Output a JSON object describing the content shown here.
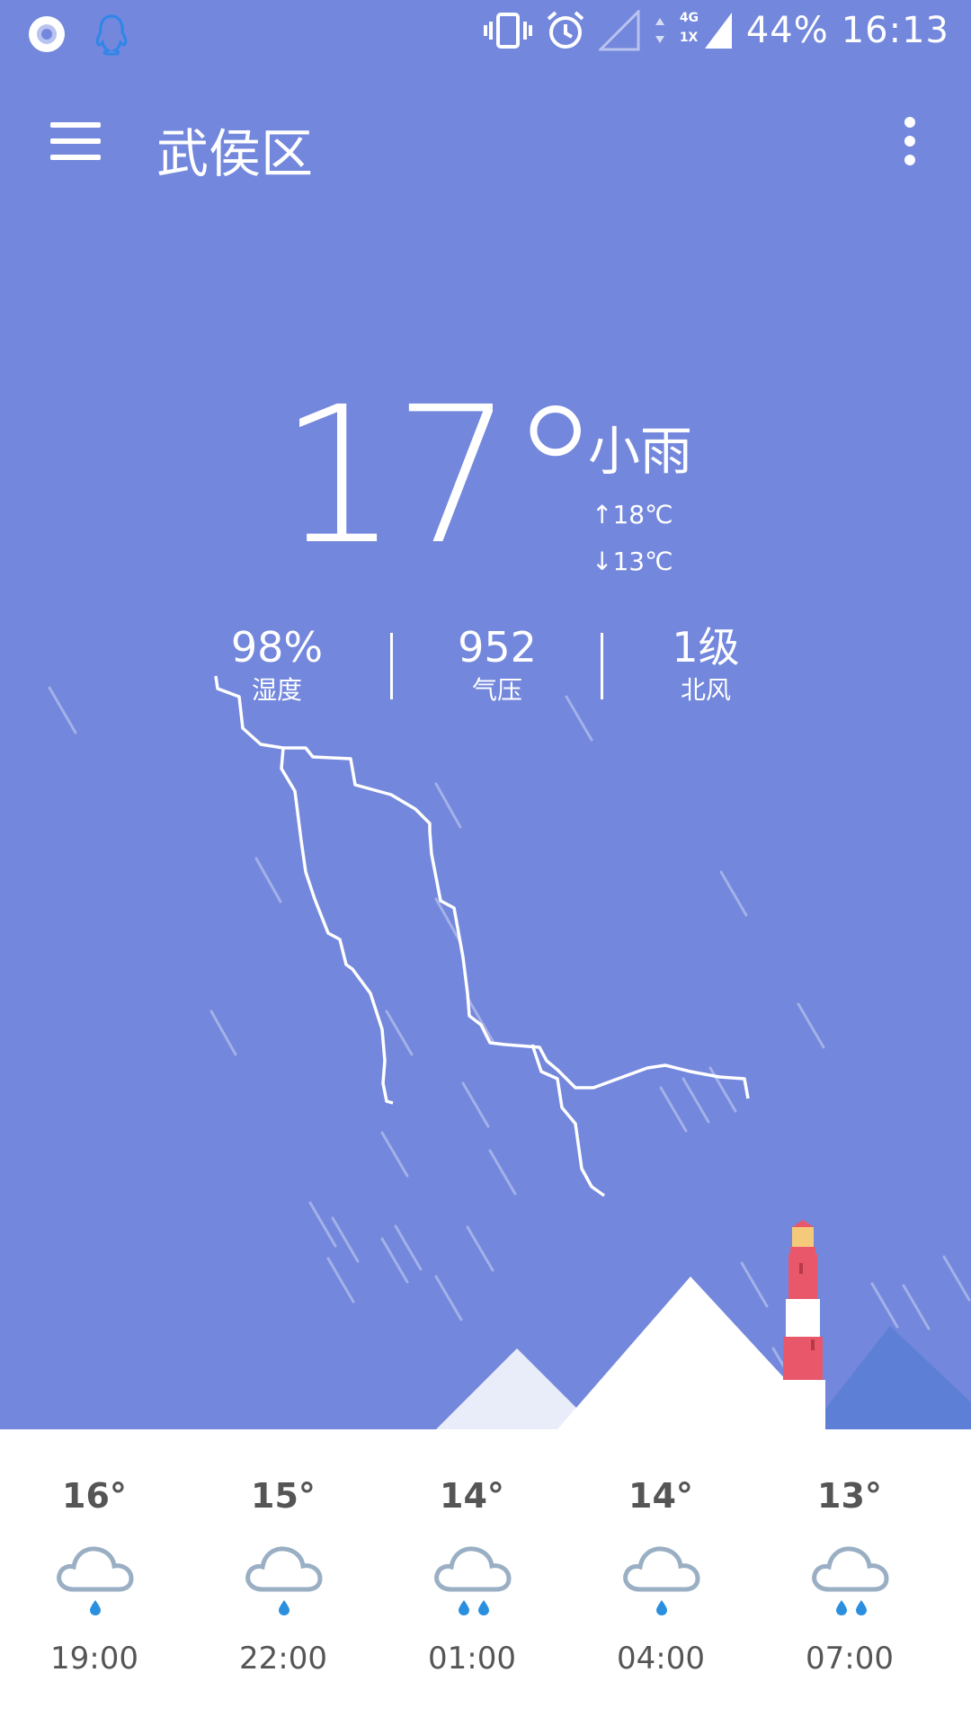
{
  "status_bar": {
    "battery": "44%",
    "time": "16:13",
    "network_top": "4G",
    "network_bottom": "1X",
    "icons": [
      "app-circle-icon",
      "qq-icon",
      "vibrate-icon",
      "alarm-icon",
      "signal-icon",
      "data-arrows-icon",
      "signal-strong-icon"
    ]
  },
  "header": {
    "city": "武侯区",
    "menu_icon": "hamburger-menu-icon",
    "more_icon": "overflow-menu-icon"
  },
  "current": {
    "temperature": "17°",
    "condition": "小雨",
    "high": "18℃",
    "low": "13℃",
    "high_arrow": "↑",
    "low_arrow": "↓"
  },
  "stats": [
    {
      "value": "98%",
      "label": "湿度"
    },
    {
      "value": "952",
      "label": "气压"
    },
    {
      "value": "1级",
      "label": "北风"
    }
  ],
  "forecast": [
    {
      "temp": "16°",
      "time": "19:00",
      "icon": "light-rain-cloud-icon"
    },
    {
      "temp": "15°",
      "time": "22:00",
      "icon": "light-rain-cloud-icon"
    },
    {
      "temp": "14°",
      "time": "01:00",
      "icon": "moderate-rain-cloud-icon"
    },
    {
      "temp": "14°",
      "time": "04:00",
      "icon": "light-rain-cloud-icon"
    },
    {
      "temp": "13°",
      "time": "07:00",
      "icon": "moderate-rain-cloud-icon"
    }
  ],
  "colors": {
    "background": "#7387dc",
    "rain_drop": "#2b8fe0",
    "cloud": "#9aafc4",
    "lighthouse_red": "#e8586a"
  }
}
